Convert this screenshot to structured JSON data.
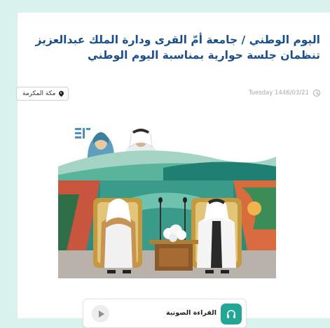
{
  "article": {
    "title": "اليوم الوطني / جامعة أمّ القرى ودارة الملك عبدالعزيز تنظمان جلسة حوارية بمناسبة اليوم الوطني",
    "location": "مكة المكرمة",
    "date": "Tuesday 1446/03/21"
  },
  "audio_player": {
    "label": "القراءة الصوتية"
  },
  "icons": {
    "location": "map-pin-icon",
    "date": "clock-icon",
    "audio": "headphones-icon",
    "play": "play-icon"
  },
  "colors": {
    "page_background": "#d9f2ee",
    "title": "#1a4f8b",
    "accent": "#22a796",
    "meta_text": "#a9a9a9"
  }
}
